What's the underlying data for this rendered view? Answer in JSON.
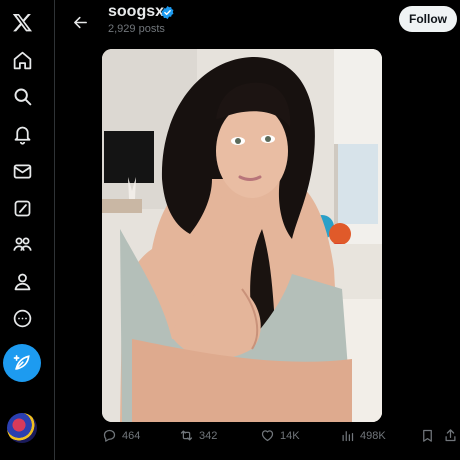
{
  "header": {
    "name": "soogsx",
    "posts": "2,929 posts",
    "follow_label": "Follow"
  },
  "sidebar": {
    "items": [
      {
        "icon": "x-logo-icon"
      },
      {
        "icon": "home-icon"
      },
      {
        "icon": "search-icon"
      },
      {
        "icon": "bell-icon"
      },
      {
        "icon": "mail-icon"
      },
      {
        "icon": "grok-icon"
      },
      {
        "icon": "communities-icon"
      },
      {
        "icon": "profile-icon"
      },
      {
        "icon": "more-icon"
      }
    ],
    "post_icon": "compose-feather-icon"
  },
  "media": {
    "subject": "selfie photo of a woman with long dark braided hair in a light grey top"
  },
  "actions": {
    "replies": "464",
    "reposts": "342",
    "likes": "14K",
    "views": "498K"
  },
  "colors": {
    "accent": "#1d9bf0",
    "text": "#e7e9ea",
    "muted": "#71767b",
    "background": "#000000"
  }
}
